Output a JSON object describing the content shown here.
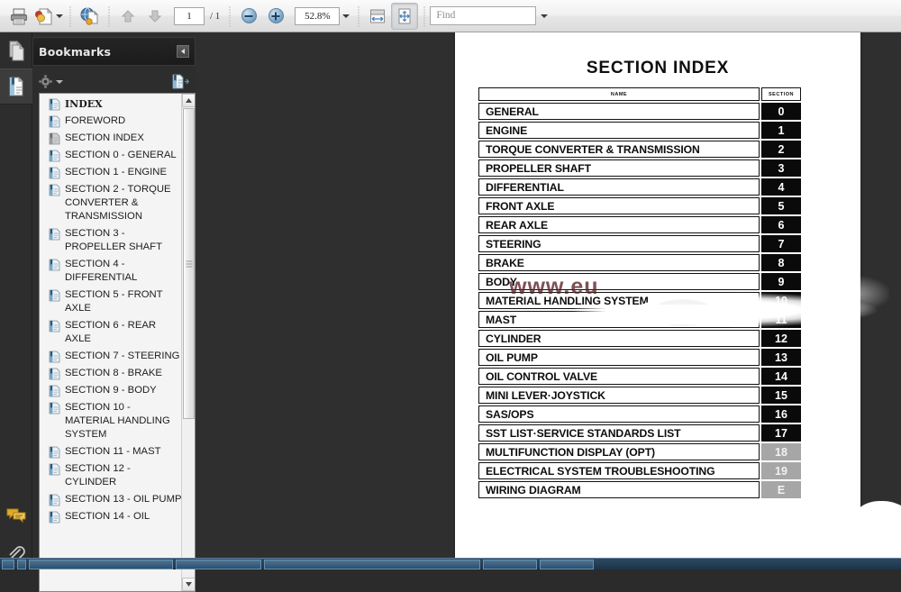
{
  "toolbar": {
    "print_label": "Print",
    "print_icon": "printer-icon",
    "snapshot_label": "Snapshot",
    "snapshot_icon": "snapshot-icon",
    "web_label": "Web Capture",
    "web_icon": "globe-page-icon",
    "prev_page_label": "Previous Page",
    "prev_page_icon": "arrow-up-icon",
    "next_page_label": "Next Page",
    "next_page_icon": "arrow-down-icon",
    "page_number": "1",
    "page_total": "/ 1",
    "zoom_out_label": "Zoom Out",
    "zoom_out_icon": "minus-circle-icon",
    "zoom_in_label": "Zoom In",
    "zoom_in_icon": "plus-circle-icon",
    "zoom_value": "52.8%",
    "zoom_dropdown_icon": "caret-down-icon",
    "fit_width_label": "Fit Width",
    "fit_width_icon": "fit-width-icon",
    "fit_page_label": "Fit Page",
    "fit_page_icon": "fit-page-icon",
    "find_placeholder": "Find",
    "find_value": "",
    "find_dropdown_icon": "caret-down-icon"
  },
  "rail": {
    "items": [
      {
        "name": "pages",
        "icon": "pages-thumbnail-icon",
        "active": false
      },
      {
        "name": "bookmarks",
        "icon": "bookmark-page-icon",
        "active": true
      },
      {
        "name": "comments",
        "icon": "comment-bubbles-icon",
        "active": false
      },
      {
        "name": "attachments",
        "icon": "paperclip-icon",
        "active": false
      }
    ]
  },
  "bookmarks_panel": {
    "title": "Bookmarks",
    "collapse_icon": "collapse-left-icon",
    "options_icon": "gear-icon",
    "options_caret_icon": "caret-down-icon",
    "expand_icon": "expand-bookmarks-icon",
    "items": [
      {
        "label": "INDEX",
        "bold": true,
        "icon": "bookmark-item-icon"
      },
      {
        "label": "FOREWORD",
        "bold": false,
        "icon": "bookmark-item-icon"
      },
      {
        "label": "SECTION INDEX",
        "bold": false,
        "icon": "bookmark-item-icon-grey"
      },
      {
        "label": "SECTION 0 - GENERAL",
        "bold": false,
        "icon": "bookmark-item-icon"
      },
      {
        "label": "SECTION 1 - ENGINE",
        "bold": false,
        "icon": "bookmark-item-icon"
      },
      {
        "label": "SECTION 2 - TORQUE CONVERTER & TRANSMISSION",
        "bold": false,
        "icon": "bookmark-item-icon"
      },
      {
        "label": "SECTION 3 - PROPELLER SHAFT",
        "bold": false,
        "icon": "bookmark-item-icon"
      },
      {
        "label": "SECTION 4 - DIFFERENTIAL",
        "bold": false,
        "icon": "bookmark-item-icon"
      },
      {
        "label": "SECTION 5 - FRONT AXLE",
        "bold": false,
        "icon": "bookmark-item-icon"
      },
      {
        "label": "SECTION 6 - REAR AXLE",
        "bold": false,
        "icon": "bookmark-item-icon"
      },
      {
        "label": "SECTION 7 - STEERING",
        "bold": false,
        "icon": "bookmark-item-icon"
      },
      {
        "label": "SECTION 8 - BRAKE",
        "bold": false,
        "icon": "bookmark-item-icon"
      },
      {
        "label": "SECTION 9 - BODY",
        "bold": false,
        "icon": "bookmark-item-icon"
      },
      {
        "label": "SECTION 10 - MATERIAL HANDLING SYSTEM",
        "bold": false,
        "icon": "bookmark-item-icon"
      },
      {
        "label": "SECTION 11 - MAST",
        "bold": false,
        "icon": "bookmark-item-icon"
      },
      {
        "label": "SECTION 12 - CYLINDER",
        "bold": false,
        "icon": "bookmark-item-icon"
      },
      {
        "label": "SECTION 13 - OIL PUMP",
        "bold": false,
        "icon": "bookmark-item-icon"
      },
      {
        "label": "SECTION 14 - OIL",
        "bold": false,
        "icon": "bookmark-item-icon"
      }
    ]
  },
  "document": {
    "page_title": "SECTION INDEX",
    "table": {
      "columns": [
        "NAME",
        "SECTION"
      ],
      "rows": [
        {
          "name": "GENERAL",
          "section": "0",
          "grey": false
        },
        {
          "name": "ENGINE",
          "section": "1",
          "grey": false
        },
        {
          "name": "TORQUE CONVERTER & TRANSMISSION",
          "section": "2",
          "grey": false
        },
        {
          "name": "PROPELLER SHAFT",
          "section": "3",
          "grey": false
        },
        {
          "name": "DIFFERENTIAL",
          "section": "4",
          "grey": false
        },
        {
          "name": "FRONT AXLE",
          "section": "5",
          "grey": false
        },
        {
          "name": "REAR AXLE",
          "section": "6",
          "grey": false
        },
        {
          "name": "STEERING",
          "section": "7",
          "grey": false
        },
        {
          "name": "BRAKE",
          "section": "8",
          "grey": false
        },
        {
          "name": "BODY",
          "section": "9",
          "grey": false
        },
        {
          "name": "MATERIAL HANDLING SYSTEM",
          "section": "10",
          "grey": false
        },
        {
          "name": "MAST",
          "section": "11",
          "grey": false
        },
        {
          "name": "CYLINDER",
          "section": "12",
          "grey": false
        },
        {
          "name": "OIL PUMP",
          "section": "13",
          "grey": false
        },
        {
          "name": "OIL CONTROL VALVE",
          "section": "14",
          "grey": false
        },
        {
          "name": "MINI LEVER·JOYSTICK",
          "section": "15",
          "grey": false
        },
        {
          "name": "SAS/OPS",
          "section": "16",
          "grey": false
        },
        {
          "name": "SST LIST·SERVICE STANDARDS LIST",
          "section": "17",
          "grey": false
        },
        {
          "name": "MULTIFUNCTION DISPLAY (OPT)",
          "section": "18",
          "grey": true
        },
        {
          "name": "ELECTRICAL SYSTEM TROUBLESHOOTING",
          "section": "19",
          "grey": true
        },
        {
          "name": "WIRING DIAGRAM",
          "section": "E",
          "grey": true
        }
      ]
    },
    "watermark_text": "www.eu",
    "watermark_color": "#5a2226"
  },
  "colors": {
    "chrome_dark": "#2d2d2d",
    "doc_background": "#2f2f2f",
    "page_white": "#ffffff",
    "section_black": "#0a0a0a",
    "section_grey": "#a6a6a6",
    "taskbar_blue": "#2d4a63"
  }
}
